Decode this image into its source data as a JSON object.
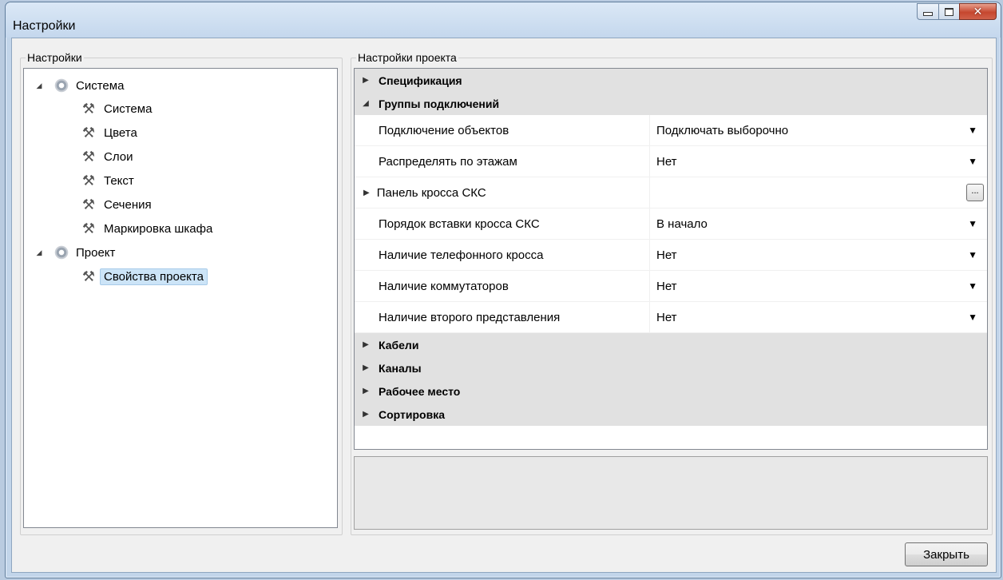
{
  "window": {
    "title": "Настройки"
  },
  "left": {
    "group_label": "Настройки",
    "tree": [
      {
        "label": "Система",
        "kind": "gear",
        "level": 0,
        "expanded": true
      },
      {
        "label": "Система",
        "kind": "tools",
        "level": 1
      },
      {
        "label": "Цвета",
        "kind": "tools",
        "level": 1
      },
      {
        "label": "Слои",
        "kind": "tools",
        "level": 1
      },
      {
        "label": "Текст",
        "kind": "tools",
        "level": 1
      },
      {
        "label": "Сечения",
        "kind": "tools",
        "level": 1
      },
      {
        "label": "Маркировка шкафа",
        "kind": "tools",
        "level": 1
      },
      {
        "label": "Проект",
        "kind": "gear",
        "level": 0,
        "expanded": true
      },
      {
        "label": "Свойства проекта",
        "kind": "tools",
        "level": 1,
        "selected": true
      }
    ]
  },
  "right": {
    "group_label": "Настройки проекта",
    "categories": {
      "spec": "Спецификация",
      "groups": "Группы подключений",
      "cables": "Кабели",
      "channels": "Каналы",
      "workplace": "Рабочее место",
      "sorting": "Сортировка"
    },
    "properties": [
      {
        "name": "Подключение объектов",
        "value": "Подключать выборочно"
      },
      {
        "name": "Распределять по этажам",
        "value": "Нет"
      },
      {
        "name": "Панель кросса СКС",
        "value": ""
      },
      {
        "name": "Порядок вставки кросса СКС",
        "value": "В начало"
      },
      {
        "name": "Наличие телефонного кросса",
        "value": "Нет"
      },
      {
        "name": "Наличие коммутаторов",
        "value": "Нет"
      },
      {
        "name": "Наличие второго представления",
        "value": "Нет"
      }
    ],
    "ellipsis_label": "..."
  },
  "footer": {
    "close_label": "Закрыть"
  },
  "colors": {
    "title_bg": "#c4d7ed",
    "selection": "#cce4f7",
    "category_bg": "#e1e1e1",
    "close_red": "#c6472f"
  },
  "icons": {
    "expanded": "triangle-down-icon",
    "collapsed": "triangle-right-icon",
    "gear": "gear-icon",
    "tools": "hammer-wrench-icon"
  }
}
